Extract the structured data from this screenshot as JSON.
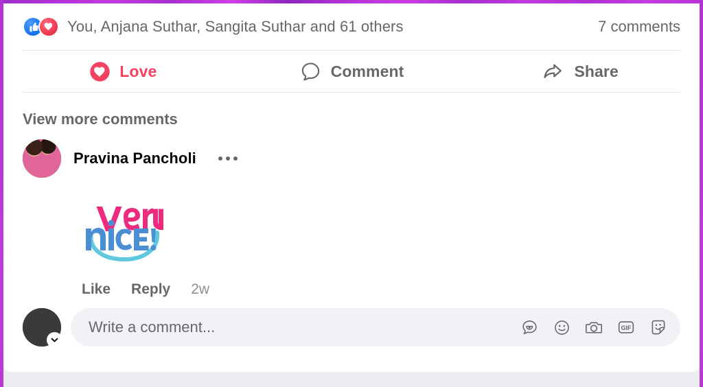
{
  "post": {
    "reactions": {
      "icons": [
        "thumbs-up-icon",
        "heart-icon"
      ],
      "summary_text": "You, Anjana Suthar, Sangita Suthar and 61 others",
      "comments_count_label": "7 comments"
    },
    "actions": [
      {
        "id": "love",
        "label": "Love",
        "icon": "heart-filled-icon",
        "active": true,
        "color": "#f3425f"
      },
      {
        "id": "comment",
        "label": "Comment",
        "icon": "speech-bubble-icon",
        "active": false,
        "color": "#65676b"
      },
      {
        "id": "share",
        "label": "Share",
        "icon": "share-arrow-icon",
        "active": false,
        "color": "#65676b"
      }
    ],
    "view_more_comments_label": "View more comments"
  },
  "comment": {
    "author_name": "Pravina Pancholi",
    "menu_icon": "ellipsis-icon",
    "sticker": {
      "line1": "very",
      "line2": "nice!",
      "line1_color": "#ec2a7e",
      "line2_color": "#4a8fd4",
      "swoosh_color": "#5fc8de"
    },
    "actions": {
      "like_label": "Like",
      "reply_label": "Reply",
      "time_label": "2w"
    }
  },
  "composer": {
    "placeholder": "Write a comment...",
    "value": "",
    "avatar_chevron_icon": "chevron-down-icon",
    "icons": [
      {
        "id": "sticker",
        "name": "sticker-bubble-icon"
      },
      {
        "id": "emoji",
        "name": "smiley-icon"
      },
      {
        "id": "camera",
        "name": "camera-icon"
      },
      {
        "id": "gif",
        "name": "gif-icon",
        "label": "GIF"
      },
      {
        "id": "avatar-sticker",
        "name": "avatar-sticker-icon"
      }
    ]
  },
  "theme": {
    "frame_color": "#b431d8",
    "card_bg": "#ffffff",
    "page_bg": "#ebedf0",
    "text_muted": "#65676b",
    "text_dark": "#050505",
    "field_bg": "#f0f2f5",
    "divider": "#e4e6eb"
  }
}
